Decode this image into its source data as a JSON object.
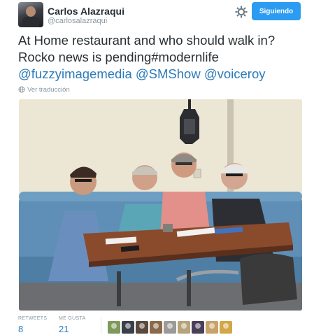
{
  "header": {
    "display_name": "Carlos Alazraqui",
    "handle": "@carlosalazraqui",
    "follow_label": "Siguiendo",
    "avatar_icon": "user-photo",
    "settings_icon": "gear-icon",
    "follow_color": "#2b9cf2"
  },
  "tweet": {
    "line1": "At Home restaurant and who should walk in?",
    "line2": "Rocko news is pending#modernlife",
    "mentions": [
      "@fuzzyimagemedia",
      "@SMShow",
      "@voiceroy"
    ],
    "translate_label": "Ver traducción",
    "mention_color": "#2b7bb9"
  },
  "stats": {
    "retweets_label": "RETWEETS",
    "retweets_count": "8",
    "likes_label": "ME GUSTA",
    "likes_count": "21"
  },
  "likers": [
    {
      "color": "#7e9a5b"
    },
    {
      "color": "#3a3f4a"
    },
    {
      "color": "#5a4a3c"
    },
    {
      "color": "#8a6a4a"
    },
    {
      "color": "#9a9a98"
    },
    {
      "color": "#b7a27a"
    },
    {
      "color": "#4a3e5a"
    },
    {
      "color": "#c7a36a"
    },
    {
      "color": "#d1a845"
    }
  ]
}
